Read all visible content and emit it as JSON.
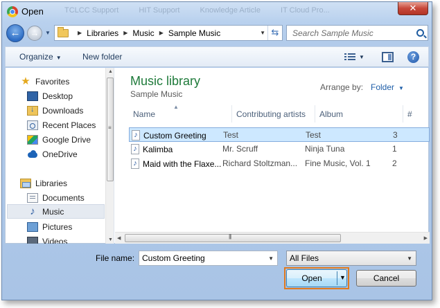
{
  "window": {
    "title": "Open",
    "close_label": "✕",
    "background_tabs": [
      "TCLCC Support",
      "HIT Support",
      "Knowledge Article",
      "IT Cloud Pro..."
    ]
  },
  "nav": {
    "back_icon": "arrow-left-icon",
    "forward_icon": "arrow-right-icon",
    "breadcrumb": [
      "Libraries",
      "Music",
      "Sample Music"
    ],
    "search_placeholder": "Search Sample Music"
  },
  "toolbar": {
    "organize_label": "Organize",
    "new_folder_label": "New folder",
    "help_label": "?"
  },
  "sidebar": {
    "favorites": [
      {
        "label": "Favorites",
        "icon": "star-icon"
      },
      {
        "label": "Desktop",
        "icon": "desktop-icon"
      },
      {
        "label": "Downloads",
        "icon": "downloads-folder-icon"
      },
      {
        "label": "Recent Places",
        "icon": "recent-places-icon"
      },
      {
        "label": "Google Drive",
        "icon": "google-drive-icon"
      },
      {
        "label": "OneDrive",
        "icon": "onedrive-icon"
      }
    ],
    "libraries": [
      {
        "label": "Libraries",
        "icon": "libraries-icon"
      },
      {
        "label": "Documents",
        "icon": "documents-icon"
      },
      {
        "label": "Music",
        "icon": "music-note-icon",
        "selected": true
      },
      {
        "label": "Pictures",
        "icon": "pictures-icon"
      },
      {
        "label": "Videos",
        "icon": "videos-icon"
      }
    ]
  },
  "main": {
    "library_title": "Music library",
    "library_subtitle": "Sample Music",
    "arrange_label": "Arrange by:",
    "arrange_value": "Folder",
    "columns": [
      "Name",
      "Contributing artists",
      "Album",
      "#"
    ],
    "rows": [
      {
        "name": "Custom Greeting",
        "artist": "Test",
        "album": "Test",
        "num": "3",
        "selected": true
      },
      {
        "name": "Kalimba",
        "artist": "Mr. Scruff",
        "album": "Ninja Tuna",
        "num": "1",
        "selected": false
      },
      {
        "name": "Maid with the Flaxe...",
        "artist": "Richard Stoltzman...",
        "album": "Fine Music, Vol. 1",
        "num": "2",
        "selected": false
      }
    ]
  },
  "footer": {
    "file_name_label": "File name:",
    "file_name_value": "Custom Greeting",
    "file_type_value": "All Files",
    "open_label": "Open",
    "cancel_label": "Cancel"
  },
  "colors": {
    "library_title": "#1e7a3a",
    "selection_bg": "#cde8ff",
    "open_highlight": "#e07a1e"
  }
}
